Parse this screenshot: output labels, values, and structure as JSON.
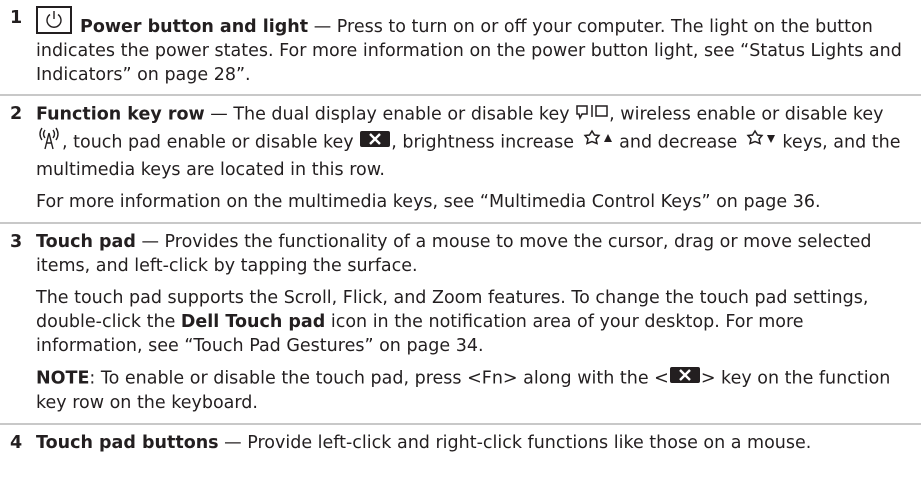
{
  "items": [
    {
      "number": "1",
      "title": "Power button and light",
      "dash": " — ",
      "text": "Press to turn on or off your computer. The light on the button indicates the power states. For more information on the power button light, see “Status Lights and Indicators” on page 28”."
    },
    {
      "number": "2",
      "title": "Function key row",
      "dash": " — ",
      "t1": "The dual display enable or disable key ",
      "t2": ", wireless enable or disable key ",
      "t3": ", touch pad enable or disable key ",
      "t4": ", brightness increase ",
      "t5": " and decrease ",
      "t6": " keys, and the multimedia keys are located in this row.",
      "para2": "For more information on the multimedia keys, see “Multimedia Control Keys” on page 36."
    },
    {
      "number": "3",
      "title": "Touch pad",
      "dash": " — ",
      "text": "Provides the functionality of a mouse to move the cursor, drag or move selected items, and left-click by tapping the surface.",
      "para2_a": "The touch pad supports the Scroll, Flick, and Zoom features. To change the touch pad settings, double-click the ",
      "para2_bold": "Dell Touch pad",
      "para2_b": " icon in the notification area of your desktop. For more information, see “Touch Pad Gestures” on page 34.",
      "note_label": "NOTE",
      "note_a": ": To enable or disable the touch pad, press <Fn> along with the <",
      "note_b": "> key on the function key row on the keyboard."
    },
    {
      "number": "4",
      "title": "Touch pad buttons",
      "dash": " — ",
      "text": "Provide left-click and right-click functions like those on a mouse."
    }
  ]
}
